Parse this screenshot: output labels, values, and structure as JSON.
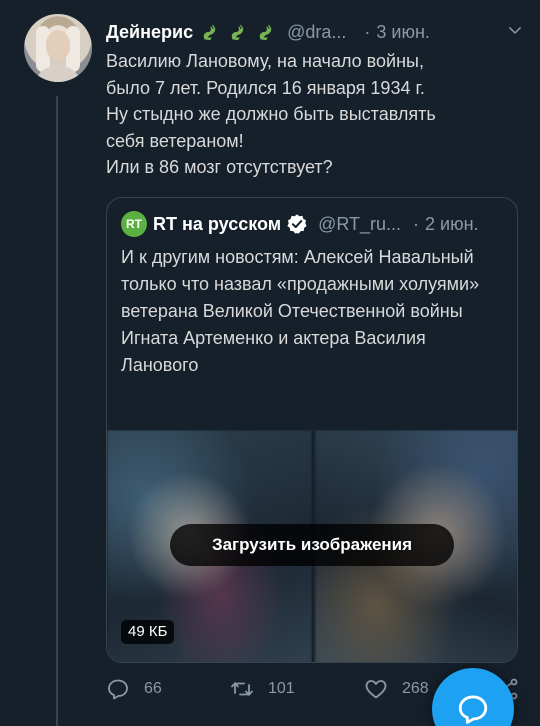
{
  "tweet": {
    "author_name": "Дейнерис",
    "author_emojis": [
      "dragon-icon",
      "dragon-icon",
      "dragon-icon"
    ],
    "handle": "@dra...",
    "separator": "·",
    "date": "3 июн.",
    "text": "Василию Лановому, на начало войны,\nбыло 7 лет. Родился 16 января 1934 г.\nНу стыдно же должно быть выставлять\nсебя ветераном!\nИли в 86 мозг отсутствует?"
  },
  "quoted_tweet": {
    "logo_text": "RT",
    "author_name": "RT на русском",
    "verified": true,
    "handle": "@RT_ru...",
    "separator": "·",
    "date": "2 июн.",
    "text": "И к другим новостям: Алексей Навальный только что назвал «продажными холуями» ветерана Великой Отечественной войны Игната Артеменко и актера Василия Ланового",
    "media": {
      "load_button_label": "Загрузить изображения",
      "size_label": "49 КБ"
    }
  },
  "actions": {
    "replies": "66",
    "retweets": "101",
    "likes": "268"
  },
  "colors": {
    "background": "#15202b",
    "border": "#38444d",
    "accent": "#1da1f2",
    "muted_text": "#8b98a5",
    "rt_logo": "#5cb043"
  }
}
